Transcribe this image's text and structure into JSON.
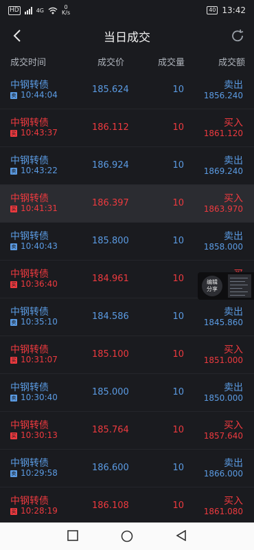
{
  "status": {
    "speed_value": "0",
    "speed_unit": "K/s",
    "hd": "HD",
    "network": "4G",
    "battery": "40",
    "time": "13:42"
  },
  "header": {
    "title": "当日成交"
  },
  "columns": {
    "time": "成交时间",
    "price": "成交价",
    "volume": "成交量",
    "amount": "成交额"
  },
  "trades": [
    {
      "name": "中钢转债",
      "side_badge": "卖",
      "time": "10:44:04",
      "price": "185.624",
      "volume": "10",
      "side": "卖出",
      "amount": "1856.240",
      "type": "sell"
    },
    {
      "name": "中钢转债",
      "side_badge": "买",
      "time": "10:43:37",
      "price": "186.112",
      "volume": "10",
      "side": "买入",
      "amount": "1861.120",
      "type": "buy"
    },
    {
      "name": "中钢转债",
      "side_badge": "卖",
      "time": "10:43:22",
      "price": "186.924",
      "volume": "10",
      "side": "卖出",
      "amount": "1869.240",
      "type": "sell"
    },
    {
      "name": "中钢转债",
      "side_badge": "买",
      "time": "10:41:31",
      "price": "186.397",
      "volume": "10",
      "side": "买入",
      "amount": "1863.970",
      "type": "buy"
    },
    {
      "name": "中钢转债",
      "side_badge": "卖",
      "time": "10:40:43",
      "price": "185.800",
      "volume": "10",
      "side": "卖出",
      "amount": "1858.000",
      "type": "sell"
    },
    {
      "name": "中钢转债",
      "side_badge": "买",
      "time": "10:36:40",
      "price": "184.961",
      "volume": "10",
      "side": "买",
      "amount": "",
      "type": "buy"
    },
    {
      "name": "中钢转债",
      "side_badge": "卖",
      "time": "10:35:10",
      "price": "184.586",
      "volume": "10",
      "side": "卖出",
      "amount": "1845.860",
      "type": "sell"
    },
    {
      "name": "中钢转债",
      "side_badge": "买",
      "time": "10:31:07",
      "price": "185.100",
      "volume": "10",
      "side": "买入",
      "amount": "1851.000",
      "type": "buy"
    },
    {
      "name": "中钢转债",
      "side_badge": "卖",
      "time": "10:30:40",
      "price": "185.000",
      "volume": "10",
      "side": "卖出",
      "amount": "1850.000",
      "type": "sell"
    },
    {
      "name": "中钢转债",
      "side_badge": "买",
      "time": "10:30:13",
      "price": "185.764",
      "volume": "10",
      "side": "买入",
      "amount": "1857.640",
      "type": "buy"
    },
    {
      "name": "中钢转债",
      "side_badge": "卖",
      "time": "10:29:58",
      "price": "186.600",
      "volume": "10",
      "side": "卖出",
      "amount": "1866.000",
      "type": "sell"
    },
    {
      "name": "中钢转债",
      "side_badge": "买",
      "time": "10:28:19",
      "price": "186.108",
      "volume": "10",
      "side": "买入",
      "amount": "1861.080",
      "type": "buy"
    }
  ],
  "floating": {
    "label": "编辑分享"
  },
  "colors": {
    "background": "#1a1b1f",
    "sell": "#5b9be3",
    "buy": "#ee3a3f",
    "highlight": "#2b2c31"
  }
}
